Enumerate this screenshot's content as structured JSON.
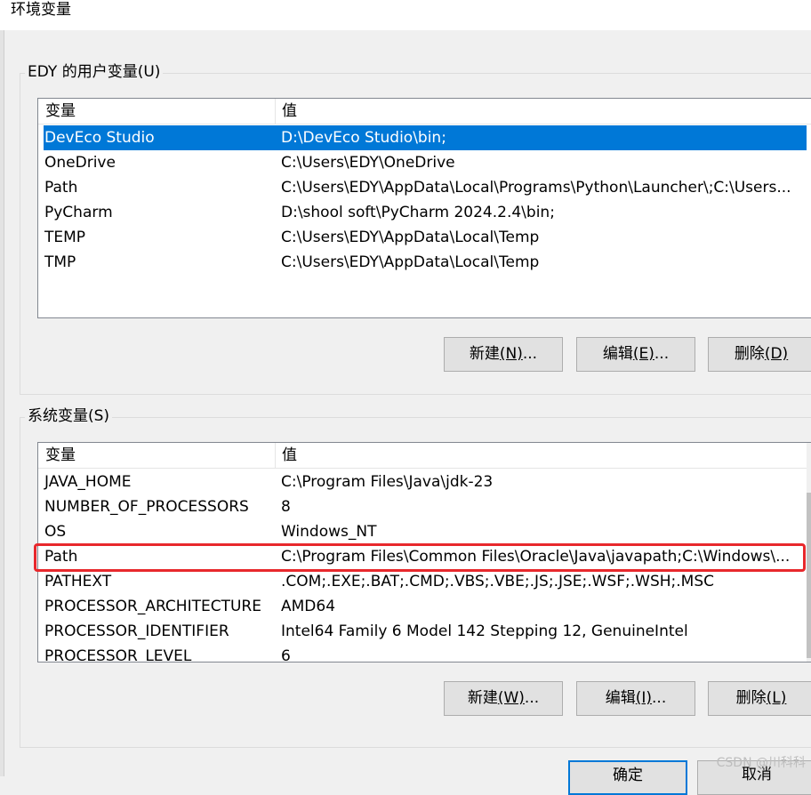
{
  "window": {
    "title": "环境变量"
  },
  "user_vars": {
    "group_label": "EDY 的用户变量(U)",
    "columns": [
      "变量",
      "值"
    ],
    "rows": [
      {
        "name": "DevEco Studio",
        "value": "D:\\DevEco Studio\\bin;",
        "selected": true
      },
      {
        "name": "OneDrive",
        "value": "C:\\Users\\EDY\\OneDrive"
      },
      {
        "name": "Path",
        "value": "C:\\Users\\EDY\\AppData\\Local\\Programs\\Python\\Launcher\\;C:\\Users..."
      },
      {
        "name": "PyCharm",
        "value": "D:\\shool soft\\PyCharm 2024.2.4\\bin;"
      },
      {
        "name": "TEMP",
        "value": "C:\\Users\\EDY\\AppData\\Local\\Temp"
      },
      {
        "name": "TMP",
        "value": "C:\\Users\\EDY\\AppData\\Local\\Temp"
      }
    ],
    "buttons": {
      "new": "新建",
      "new_key": "(N)",
      "new_tail": "...",
      "edit": "编辑",
      "edit_key": "(E)",
      "edit_tail": "...",
      "delete": "删除",
      "delete_key": "(D)"
    }
  },
  "system_vars": {
    "group_label": "系统变量(S)",
    "columns": [
      "变量",
      "值"
    ],
    "rows": [
      {
        "name": "JAVA_HOME",
        "value": "C:\\Program Files\\Java\\jdk-23"
      },
      {
        "name": "NUMBER_OF_PROCESSORS",
        "value": "8"
      },
      {
        "name": "OS",
        "value": "Windows_NT"
      },
      {
        "name": "Path",
        "value": "C:\\Program Files\\Common Files\\Oracle\\Java\\javapath;C:\\Windows\\..."
      },
      {
        "name": "PATHEXT",
        "value": ".COM;.EXE;.BAT;.CMD;.VBS;.VBE;.JS;.JSE;.WSF;.WSH;.MSC"
      },
      {
        "name": "PROCESSOR_ARCHITECTURE",
        "value": "AMD64"
      },
      {
        "name": "PROCESSOR_IDENTIFIER",
        "value": "Intel64 Family 6 Model 142 Stepping 12, GenuineIntel"
      },
      {
        "name": "PROCESSOR_LEVEL",
        "value": "6"
      }
    ],
    "buttons": {
      "new": "新建",
      "new_key": "(W)",
      "new_tail": "...",
      "edit": "编辑",
      "edit_key": "(I)",
      "edit_tail": "...",
      "delete": "删除",
      "delete_key": "(L)"
    }
  },
  "footer": {
    "ok": "确定",
    "cancel": "取消"
  },
  "watermark": "CSDN @川科科",
  "colors": {
    "selection": "#0078d7",
    "highlight_box": "#e8282c",
    "primary_border": "#0078d7"
  }
}
